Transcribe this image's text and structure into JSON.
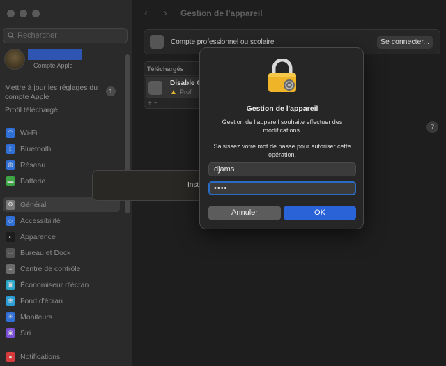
{
  "sidebar": {
    "search_placeholder": "Rechercher",
    "account_subtitle": "Compte Apple",
    "update_text": "Mettre à jour les réglages du compte Apple",
    "update_badge": "1",
    "profile_downloaded": "Profil téléchargé",
    "items": [
      {
        "label": "Wi-Fi",
        "icon": "wifi-icon",
        "color": "#2f6fd6",
        "glyph": "◠"
      },
      {
        "label": "Bluetooth",
        "icon": "bluetooth-icon",
        "color": "#2f6fd6",
        "glyph": "ᛒ"
      },
      {
        "label": "Réseau",
        "icon": "globe-icon",
        "color": "#2f6fd6",
        "glyph": "◍"
      },
      {
        "label": "Batterie",
        "icon": "battery-icon",
        "color": "#3da544",
        "glyph": "▬"
      },
      {
        "label": "Général",
        "icon": "gear-icon",
        "color": "#7a7a7a",
        "glyph": "⚙"
      },
      {
        "label": "Accessibilité",
        "icon": "accessibility-icon",
        "color": "#2f6fd6",
        "glyph": "☺"
      },
      {
        "label": "Apparence",
        "icon": "appearance-icon",
        "color": "#1c1c1c",
        "glyph": "◐"
      },
      {
        "label": "Bureau et Dock",
        "icon": "dock-icon",
        "color": "#555555",
        "glyph": "▭"
      },
      {
        "label": "Centre de contrôle",
        "icon": "control-center-icon",
        "color": "#6b6b6b",
        "glyph": "≡"
      },
      {
        "label": "Économiseur d'écran",
        "icon": "screensaver-icon",
        "color": "#2aa6c9",
        "glyph": "▣"
      },
      {
        "label": "Fond d'écran",
        "icon": "wallpaper-icon",
        "color": "#2a9fd6",
        "glyph": "❀"
      },
      {
        "label": "Moniteurs",
        "icon": "display-icon",
        "color": "#2f6fd6",
        "glyph": "☀"
      },
      {
        "label": "Siri",
        "icon": "siri-icon",
        "color": "#7a4fd6",
        "glyph": "◉"
      },
      {
        "label": "Notifications",
        "icon": "notifications-icon",
        "color": "#d63a3a",
        "glyph": "●"
      }
    ]
  },
  "main": {
    "title": "Gestion de l'appareil",
    "card_label": "Compte professionnel ou scolaire",
    "connect_button": "Se connecter...",
    "downloads_header": "Téléchargés",
    "download_title": "Disable G",
    "download_sub": "Profi",
    "add_remove": "+  −",
    "help": "?"
  },
  "background_dialog": {
    "text": "Inst"
  },
  "auth_dialog": {
    "title": "Gestion de l'appareil",
    "message": "Gestion de l'appareil souhaite effectuer des modifications.",
    "prompt": "Saisissez votre mot de passe pour autoriser cette opération.",
    "username": "djams",
    "password_mask": "••••",
    "cancel_label": "Annuler",
    "ok_label": "OK"
  },
  "colors": {
    "accent": "#2a62d8",
    "focus_ring": "#2a6cc4",
    "lock_gold": "#f0b429"
  }
}
